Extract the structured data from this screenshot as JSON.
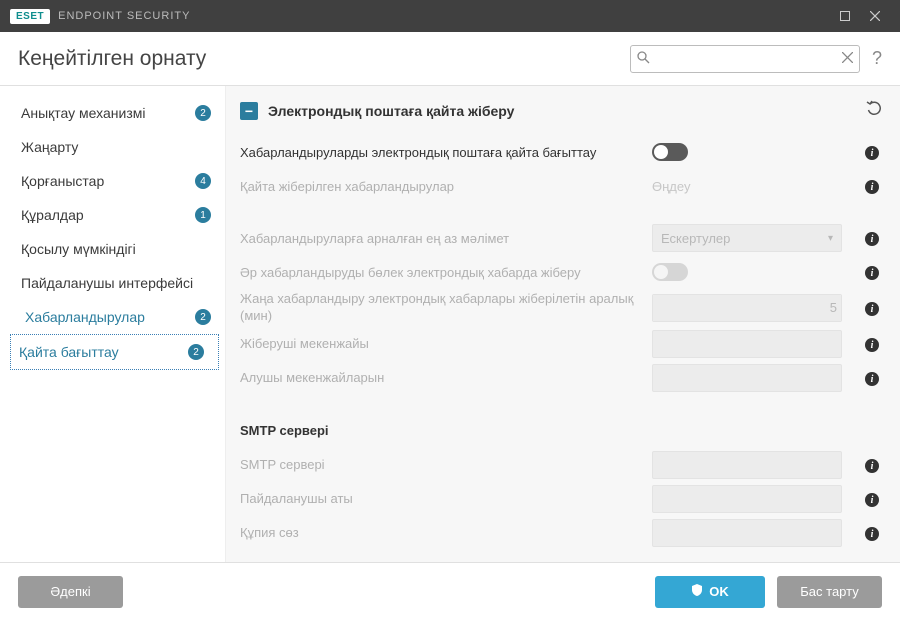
{
  "titlebar": {
    "brand": "ESET",
    "product": "ENDPOINT SECURITY"
  },
  "header": {
    "title": "Кеңейтілген орнату",
    "search_placeholder": ""
  },
  "sidebar": {
    "items": [
      {
        "label": "Анықтау механизмі",
        "badge": "2"
      },
      {
        "label": "Жаңарту",
        "badge": null
      },
      {
        "label": "Қорғаныстар",
        "badge": "4"
      },
      {
        "label": "Құралдар",
        "badge": "1"
      },
      {
        "label": "Қосылу мүмкіндігі",
        "badge": null
      },
      {
        "label": "Пайдаланушы интерфейсі",
        "badge": null
      },
      {
        "label": "Хабарландырулар",
        "badge": "2"
      },
      {
        "label": "Қайта бағыттау",
        "badge": "2"
      }
    ]
  },
  "section": {
    "title": "Электрондық поштаға қайта жіберу",
    "rows": {
      "forward_toggle": "Хабарландыруларды электрондық поштаға қайта бағыттау",
      "resent_notifications": "Қайта жіберілген хабарландырулар",
      "resent_link": "Өңдеу",
      "min_info": "Хабарландыруларға арналған ең аз мәлімет",
      "min_info_value": "Ескертулер",
      "send_separate": "Әр хабарландыруды бөлек электрондық хабарда жіберу",
      "interval": "Жаңа хабарландыру электрондық хабарлары жіберілетін аралық (мин)",
      "interval_value": "5",
      "sender": "Жіберуші мекенжайы",
      "recipients": "Алушы мекенжайларын"
    },
    "smtp_heading": "SMTP сервері",
    "smtp": {
      "server": "SMTP сервері",
      "username": "Пайдаланушы аты",
      "password": "Құпия сөз"
    }
  },
  "footer": {
    "default": "Әдепкі",
    "ok": "OK",
    "cancel": "Бас тарту"
  }
}
